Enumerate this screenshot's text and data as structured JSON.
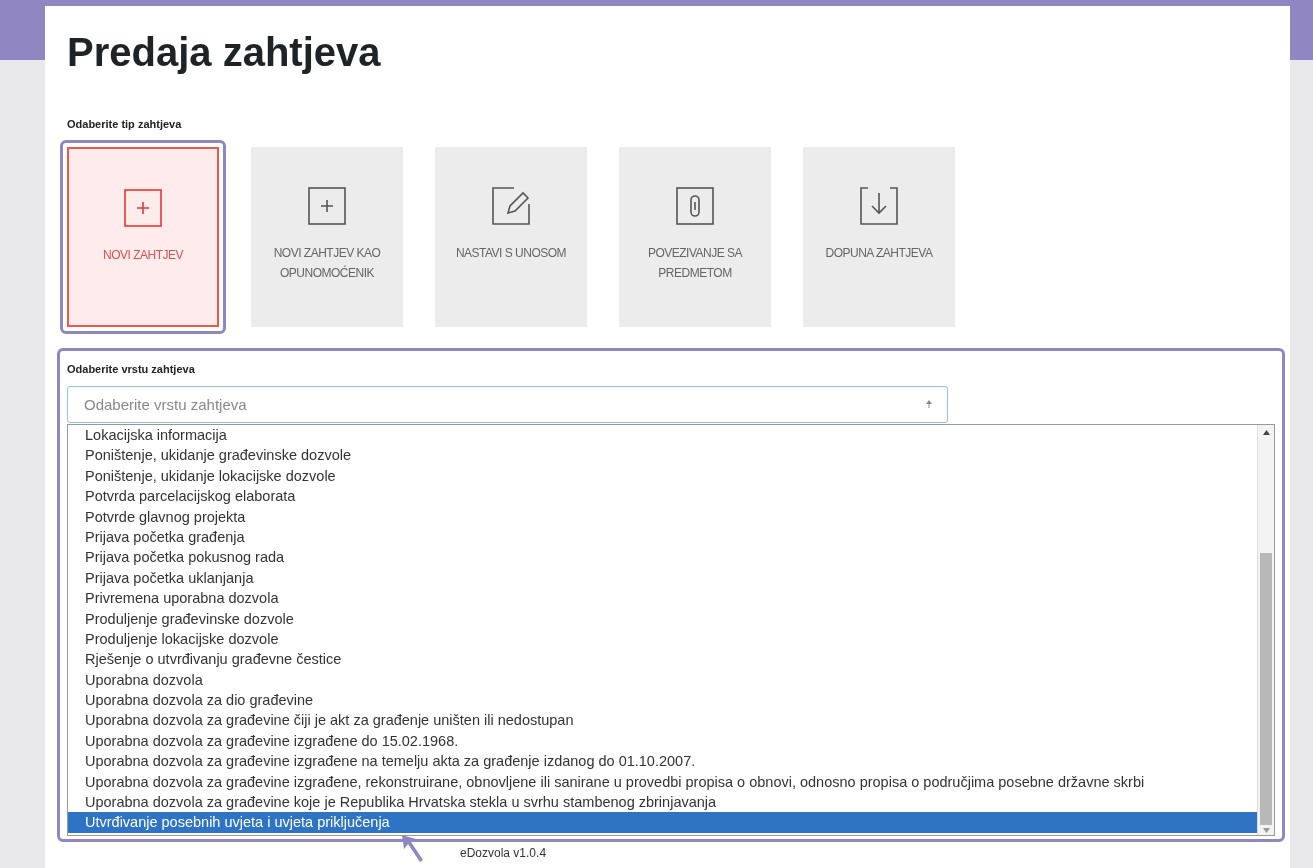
{
  "title": "Predaja zahtjeva",
  "type_section": {
    "label": "Odaberite tip zahtjeva",
    "cards": [
      {
        "kind": "plus",
        "label": "NOVI ZAHTJEV",
        "selected": true
      },
      {
        "kind": "plus",
        "label": "NOVI ZAHTJEV KAO OPUNOMOĆENIK",
        "selected": false
      },
      {
        "kind": "edit",
        "label": "NASTAVI S UNOSOM",
        "selected": false
      },
      {
        "kind": "link",
        "label": "POVEZIVANJE SA PREDMETOM",
        "selected": false
      },
      {
        "kind": "download",
        "label": "DOPUNA ZAHTJEVA",
        "selected": false
      }
    ]
  },
  "kind_section": {
    "label": "Odaberite vrstu zahtjeva",
    "select": {
      "placeholder": "Odaberite vrstu zahtjeva"
    },
    "options": [
      {
        "label": "Lokacijska informacija",
        "selected": false
      },
      {
        "label": "Poništenje, ukidanje građevinske dozvole",
        "selected": false
      },
      {
        "label": "Poništenje, ukidanje lokacijske dozvole",
        "selected": false
      },
      {
        "label": "Potvrda parcelacijskog elaborata",
        "selected": false
      },
      {
        "label": "Potvrde glavnog projekta",
        "selected": false
      },
      {
        "label": "Prijava početka građenja",
        "selected": false
      },
      {
        "label": "Prijava početka pokusnog rada",
        "selected": false
      },
      {
        "label": "Prijava početka uklanjanja",
        "selected": false
      },
      {
        "label": "Privremena uporabna dozvola",
        "selected": false
      },
      {
        "label": "Produljenje građevinske dozvole",
        "selected": false
      },
      {
        "label": "Produljenje lokacijske dozvole",
        "selected": false
      },
      {
        "label": "Rješenje o utvrđivanju građevne čestice",
        "selected": false
      },
      {
        "label": "Uporabna dozvola",
        "selected": false
      },
      {
        "label": "Uporabna dozvola za dio građevine",
        "selected": false
      },
      {
        "label": "Uporabna dozvola za građevine čiji je akt za građenje uništen ili nedostupan",
        "selected": false
      },
      {
        "label": "Uporabna dozvola za građevine izgrađene do 15.02.1968.",
        "selected": false
      },
      {
        "label": "Uporabna dozvola za građevine izgrađene na temelju akta za građenje izdanog do 01.10.2007.",
        "selected": false
      },
      {
        "label": "Uporabna dozvola za građevine izgrađene, rekonstruirane, obnovljene ili sanirane u provedbi propisa o obnovi, odnosno propisa o područjima posebne državne skrbi",
        "selected": false
      },
      {
        "label": "Uporabna dozvola za građevine koje je Republika Hrvatska stekla u svrhu stambenog zbrinjavanja",
        "selected": false
      },
      {
        "label": "Utvrđivanje posebnih uvjeta i uvjeta priključenja",
        "selected": true
      }
    ]
  },
  "footer": "eDozvola v1.0.4"
}
